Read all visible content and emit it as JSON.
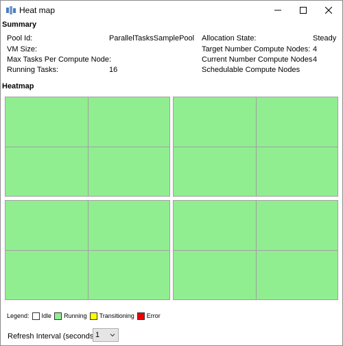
{
  "window": {
    "title": "Heat map"
  },
  "summary": {
    "heading": "Summary",
    "pool_id_label": "Pool Id:",
    "pool_id_value": "ParallelTasksSamplePool",
    "vm_size_label": "VM Size:",
    "vm_size_value": "",
    "max_tasks_label": "Max Tasks Per Compute Node:",
    "max_tasks_value": "",
    "running_tasks_label": "Running Tasks:",
    "running_tasks_value": "16",
    "allocation_state_label": "Allocation State:",
    "allocation_state_value": "Steady",
    "target_nodes_label": "Target Number Compute Nodes:",
    "target_nodes_value": "4",
    "current_nodes_label": "Current Number Compute Nodes",
    "current_nodes_value": "4",
    "schedulable_nodes_label": "Schedulable Compute Nodes",
    "schedulable_nodes_value": ""
  },
  "heatmap": {
    "heading": "Heatmap",
    "nodes": [
      {
        "state": "Running",
        "slots": [
          "Running",
          "Running",
          "Running",
          "Running"
        ]
      },
      {
        "state": "Running",
        "slots": [
          "Running",
          "Running",
          "Running",
          "Running"
        ]
      },
      {
        "state": "Running",
        "slots": [
          "Running",
          "Running",
          "Running",
          "Running"
        ]
      },
      {
        "state": "Running",
        "slots": [
          "Running",
          "Running",
          "Running",
          "Running"
        ]
      }
    ]
  },
  "legend": {
    "label": "Legend:",
    "items": [
      {
        "label": "Idle",
        "color": "#ffffff"
      },
      {
        "label": "Running",
        "color": "#90ee90"
      },
      {
        "label": "Transitioning",
        "color": "#ffff00"
      },
      {
        "label": "Error",
        "color": "#ee0000"
      }
    ]
  },
  "refresh": {
    "label": "Refresh Interval (seconds):",
    "selected": "1"
  }
}
